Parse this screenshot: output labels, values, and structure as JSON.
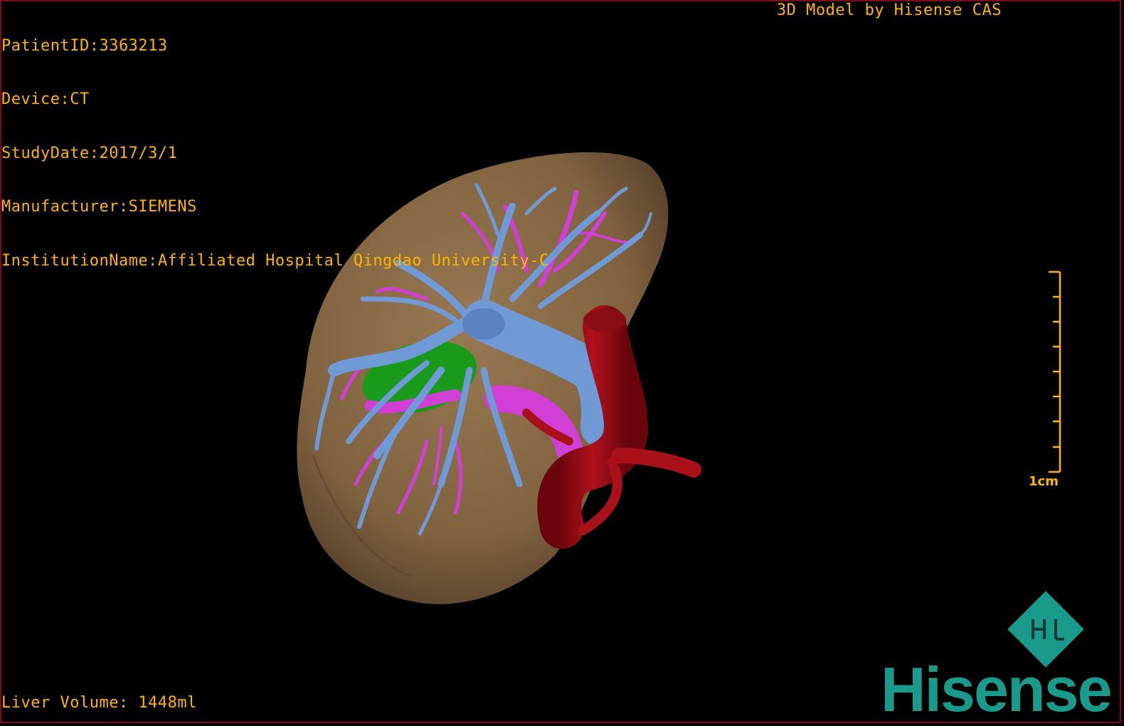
{
  "overlay": {
    "patient_id": "PatientID:3363213",
    "device": "Device:CT",
    "study_date": "StudyDate:2017/3/1",
    "manufacturer": "Manufacturer:SIEMENS",
    "institution": "InstitutionName:Affiliated Hospital Qingdao University-C",
    "model_credit": "3D Model by Hisense CAS",
    "liver_volume": "Liver Volume: 1448ml"
  },
  "scalebar": {
    "label": "1cm"
  },
  "brand": {
    "name": "Hisense",
    "color": "#1a9a8a"
  },
  "colors": {
    "overlay_text": "#ffb400",
    "liver": "#8a6a44",
    "portal_vein": "#6f9ad6",
    "hepatic_vein": "#d23fd6",
    "aorta": "#a8101a",
    "gallbladder": "#1a9a1a",
    "viewport_border": "#7a0a14"
  }
}
